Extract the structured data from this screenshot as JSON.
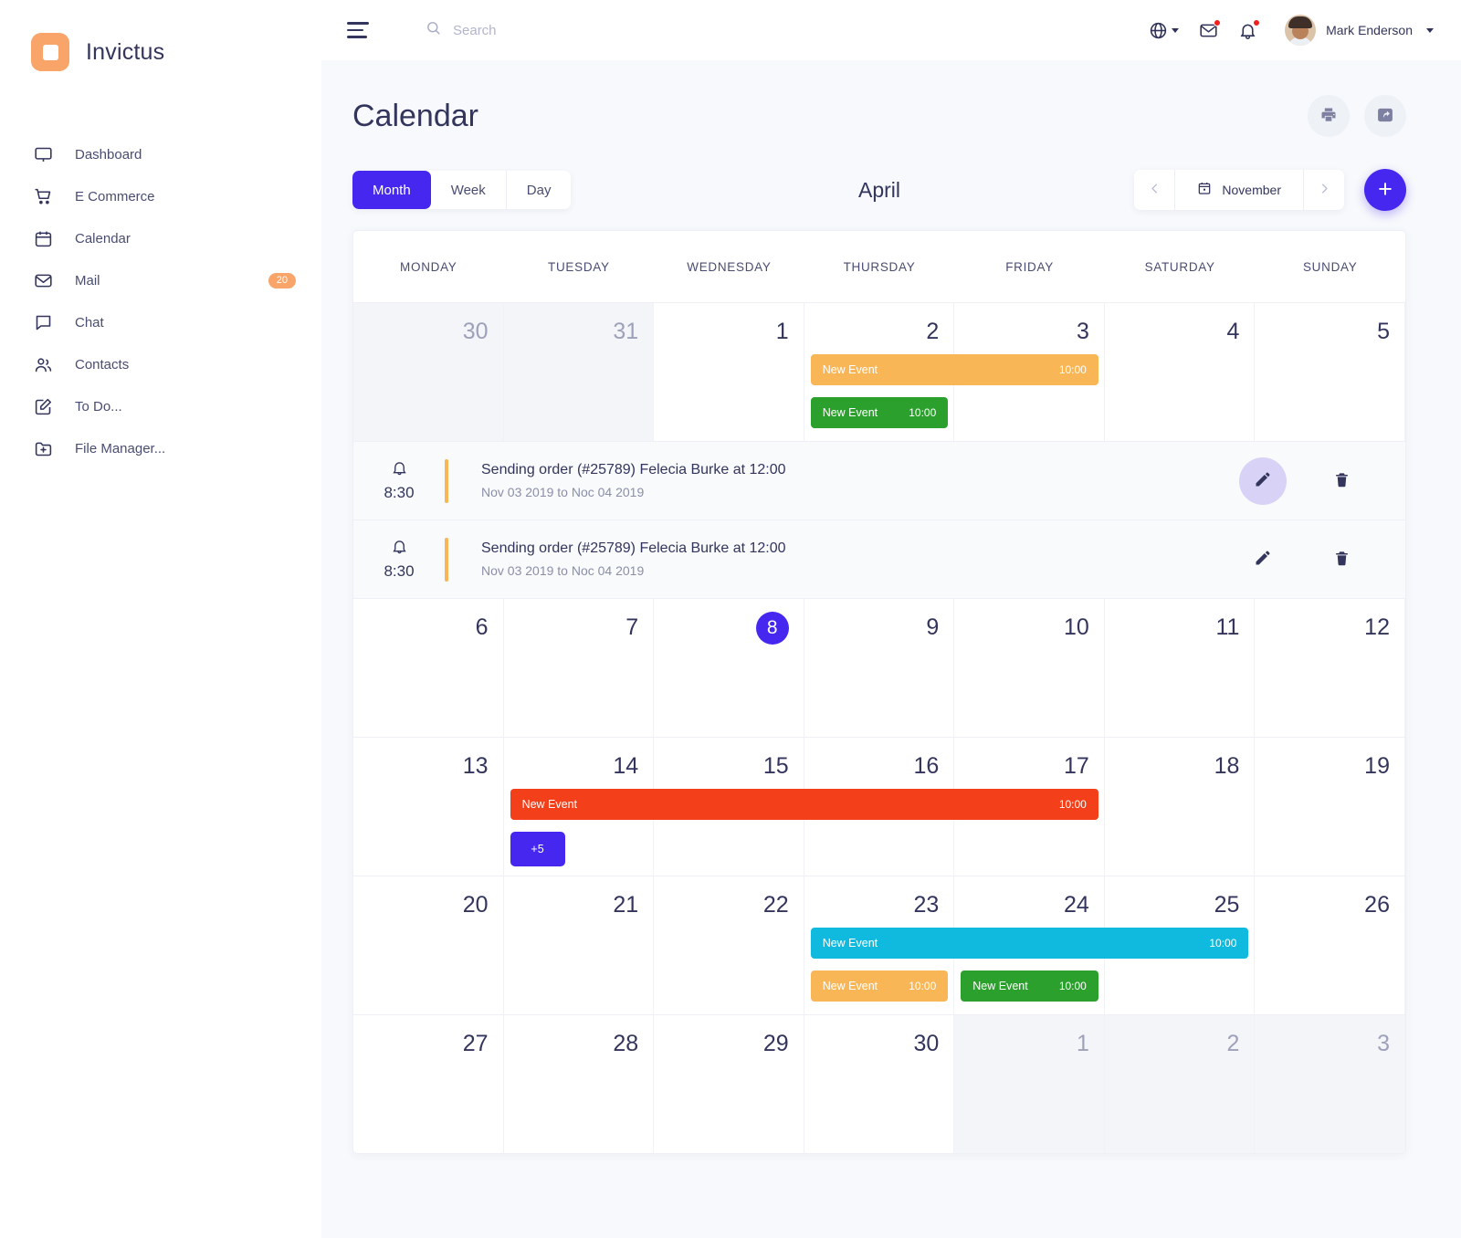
{
  "brand": {
    "name": "Invictus",
    "logo_color": "#F9A469"
  },
  "sidebar": {
    "items": [
      {
        "label": "Dashboard",
        "icon": "monitor-icon",
        "badge": null
      },
      {
        "label": "E Commerce",
        "icon": "cart-icon",
        "badge": null
      },
      {
        "label": "Calendar",
        "icon": "calendar-icon",
        "badge": null
      },
      {
        "label": "Mail",
        "icon": "mail-icon",
        "badge": "20"
      },
      {
        "label": "Chat",
        "icon": "chat-icon",
        "badge": null
      },
      {
        "label": "Contacts",
        "icon": "contacts-icon",
        "badge": null
      },
      {
        "label": "To Do...",
        "icon": "edit-square-icon",
        "badge": null
      },
      {
        "label": "File Manager...",
        "icon": "folder-plus-icon",
        "badge": null
      }
    ]
  },
  "topbar": {
    "menu_icon": "hamburger-icon",
    "search": {
      "placeholder": "Search",
      "value": "",
      "icon": "search-icon"
    },
    "language_icon": "globe-icon",
    "mail_icon": "envelope-icon",
    "notification_icon": "bell-icon",
    "user_name": "Mark Enderson"
  },
  "page": {
    "title": "Calendar",
    "print_label": "print-icon",
    "share_label": "share-icon"
  },
  "toolbar": {
    "views": [
      {
        "label": "Month",
        "active": true
      },
      {
        "label": "Week",
        "active": false
      },
      {
        "label": "Day",
        "active": false
      }
    ],
    "current_month": "April",
    "nav_month": "November",
    "prev_label": "chevron-left-icon",
    "next_label": "chevron-right-icon",
    "add_label": "+"
  },
  "calendar": {
    "weekdays": [
      "MONDAY",
      "TUESDAY",
      "WEDNESDAY",
      "THURSDAY",
      "FRIDAY",
      "SATURDAY",
      "SUNDAY"
    ],
    "today": 8,
    "colors": {
      "orange": "#F9B656",
      "green": "#2CA02C",
      "red": "#F4401A",
      "cyan": "#10B9DE",
      "purple": "#4527F0"
    },
    "rows": [
      {
        "days": [
          {
            "num": "30",
            "muted": true
          },
          {
            "num": "31",
            "muted": true
          },
          {
            "num": "1",
            "muted": false
          },
          {
            "num": "2",
            "muted": false
          },
          {
            "num": "3",
            "muted": false
          },
          {
            "num": "4",
            "muted": false
          },
          {
            "num": "5",
            "muted": false
          }
        ],
        "events": [
          {
            "title": "New Event",
            "time": "10:00",
            "color": "#F9B656",
            "start": 3,
            "span": 2,
            "lane": 0
          },
          {
            "title": "New Event",
            "time": "10:00",
            "color": "#2CA02C",
            "start": 3,
            "span": 1,
            "lane": 1
          }
        ]
      },
      {
        "days": [
          {
            "num": "6",
            "muted": false
          },
          {
            "num": "7",
            "muted": false
          },
          {
            "num": "8",
            "muted": false
          },
          {
            "num": "9",
            "muted": false
          },
          {
            "num": "10",
            "muted": false
          },
          {
            "num": "11",
            "muted": false
          },
          {
            "num": "12",
            "muted": false
          }
        ],
        "events": []
      },
      {
        "days": [
          {
            "num": "13",
            "muted": false
          },
          {
            "num": "14",
            "muted": false
          },
          {
            "num": "15",
            "muted": false
          },
          {
            "num": "16",
            "muted": false
          },
          {
            "num": "17",
            "muted": false
          },
          {
            "num": "18",
            "muted": false
          },
          {
            "num": "19",
            "muted": false
          }
        ],
        "events": [
          {
            "title": "New Event",
            "time": "10:00",
            "color": "#F4401A",
            "start": 1,
            "span": 4,
            "lane": 0
          }
        ],
        "pills": [
          {
            "label": "+5",
            "start": 1,
            "lane": 1
          }
        ]
      },
      {
        "days": [
          {
            "num": "20",
            "muted": false
          },
          {
            "num": "21",
            "muted": false
          },
          {
            "num": "22",
            "muted": false
          },
          {
            "num": "23",
            "muted": false
          },
          {
            "num": "24",
            "muted": false
          },
          {
            "num": "25",
            "muted": false
          },
          {
            "num": "26",
            "muted": false
          }
        ],
        "events": [
          {
            "title": "New Event",
            "time": "10:00",
            "color": "#10B9DE",
            "start": 3,
            "span": 3,
            "lane": 0
          },
          {
            "title": "New Event",
            "time": "10:00",
            "color": "#F9B656",
            "start": 3,
            "span": 1,
            "lane": 1
          },
          {
            "title": "New Event",
            "time": "10:00",
            "color": "#2CA02C",
            "start": 4,
            "span": 1,
            "lane": 1
          }
        ]
      },
      {
        "days": [
          {
            "num": "27",
            "muted": false
          },
          {
            "num": "28",
            "muted": false
          },
          {
            "num": "29",
            "muted": false
          },
          {
            "num": "30",
            "muted": false
          },
          {
            "num": "1",
            "muted": true
          },
          {
            "num": "2",
            "muted": true
          },
          {
            "num": "3",
            "muted": true
          }
        ],
        "events": []
      }
    ],
    "reminders": [
      {
        "time": "8:30",
        "title": "Sending order (#25789) Felecia Burke at 12:00",
        "subtitle": "Nov 03 2019 to Noc 04 2019",
        "accent": "#F9B656",
        "edit_highlight": true
      },
      {
        "time": "8:30",
        "title": "Sending order (#25789) Felecia Burke at 12:00",
        "subtitle": "Nov 03 2019 to Noc 04 2019",
        "accent": "#F9B656",
        "edit_highlight": false
      }
    ]
  }
}
